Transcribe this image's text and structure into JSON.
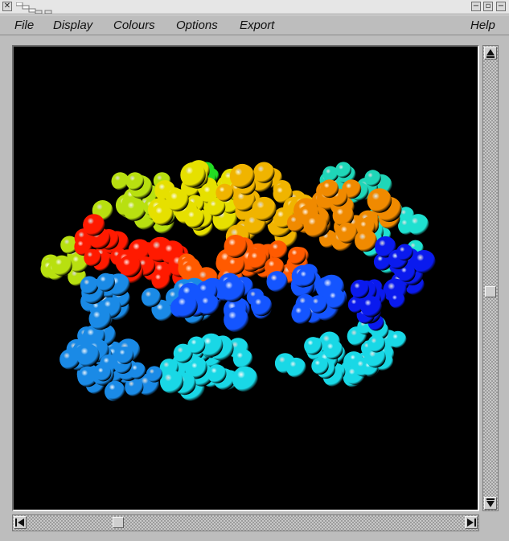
{
  "window": {
    "close_glyph": "✕",
    "minimize_glyph": "−",
    "maximize_glyph": "▫"
  },
  "menubar": {
    "file": "File",
    "display": "Display",
    "colours": "Colours",
    "options": "Options",
    "export": "Export",
    "help": "Help"
  },
  "scrollbars": {
    "vertical_position": 0.53,
    "horizontal_position": 0.2
  },
  "viewport": {
    "background": "#000000",
    "rendering": "space-filling protein molecule, rainbow coloured by chain position"
  }
}
